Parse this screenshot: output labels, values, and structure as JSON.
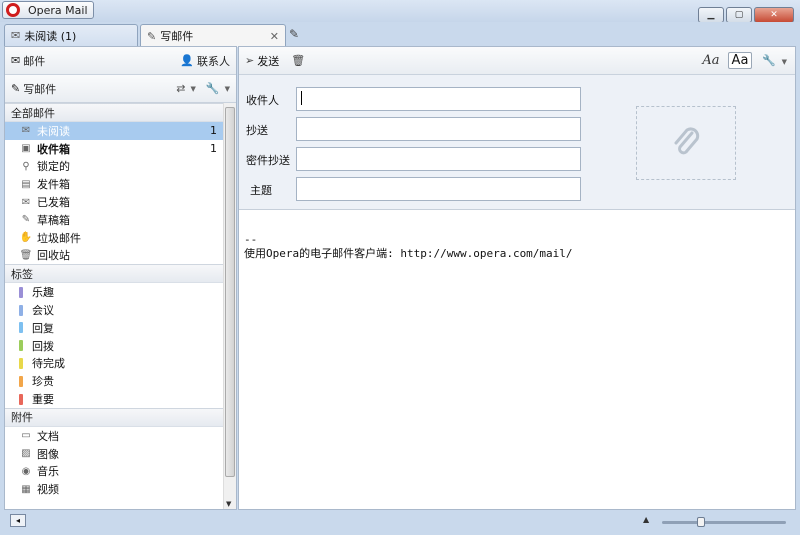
{
  "window": {
    "title": "Opera Mail"
  },
  "tabs": [
    {
      "label": "未阅读 (1)"
    },
    {
      "label": "写邮件"
    }
  ],
  "sidebar": {
    "mail_label": "邮件",
    "contacts_label": "联系人",
    "compose_label": "写邮件",
    "sections": {
      "all_mail": "全部邮件",
      "labels": "标签",
      "attachments": "附件"
    },
    "mail_items": [
      {
        "label": "未阅读",
        "count": "1"
      },
      {
        "label": "收件箱",
        "count": "1"
      },
      {
        "label": "锁定的",
        "count": ""
      },
      {
        "label": "发件箱",
        "count": ""
      },
      {
        "label": "已发箱",
        "count": ""
      },
      {
        "label": "草稿箱",
        "count": ""
      },
      {
        "label": "垃圾邮件",
        "count": ""
      },
      {
        "label": "回收站",
        "count": ""
      }
    ],
    "label_items": [
      {
        "label": "乐趣",
        "color": "#9a8fd6"
      },
      {
        "label": "会议",
        "color": "#8fb0e6"
      },
      {
        "label": "回复",
        "color": "#7ec0f0"
      },
      {
        "label": "回拨",
        "color": "#9ccd5c"
      },
      {
        "label": "待完成",
        "color": "#e8d84a"
      },
      {
        "label": "珍贵",
        "color": "#f2a64a"
      },
      {
        "label": "重要",
        "color": "#e8675a"
      }
    ],
    "attachment_items": [
      {
        "label": "文档"
      },
      {
        "label": "图像"
      },
      {
        "label": "音乐"
      },
      {
        "label": "视频"
      }
    ]
  },
  "toolbar": {
    "send_label": "发送",
    "font_style_label": "Aa",
    "font_box_label": "Aa"
  },
  "compose": {
    "to_label": "收件人",
    "cc_label": "抄送",
    "bcc_label": "密件抄送",
    "subject_label": "主题",
    "to_value": "",
    "cc_value": "",
    "bcc_value": "",
    "subject_value": "",
    "body_lines": [
      "--",
      "使用Opera的电子邮件客户端: http://www.opera.com/mail/"
    ]
  },
  "zoom": {
    "level": 0.3
  }
}
